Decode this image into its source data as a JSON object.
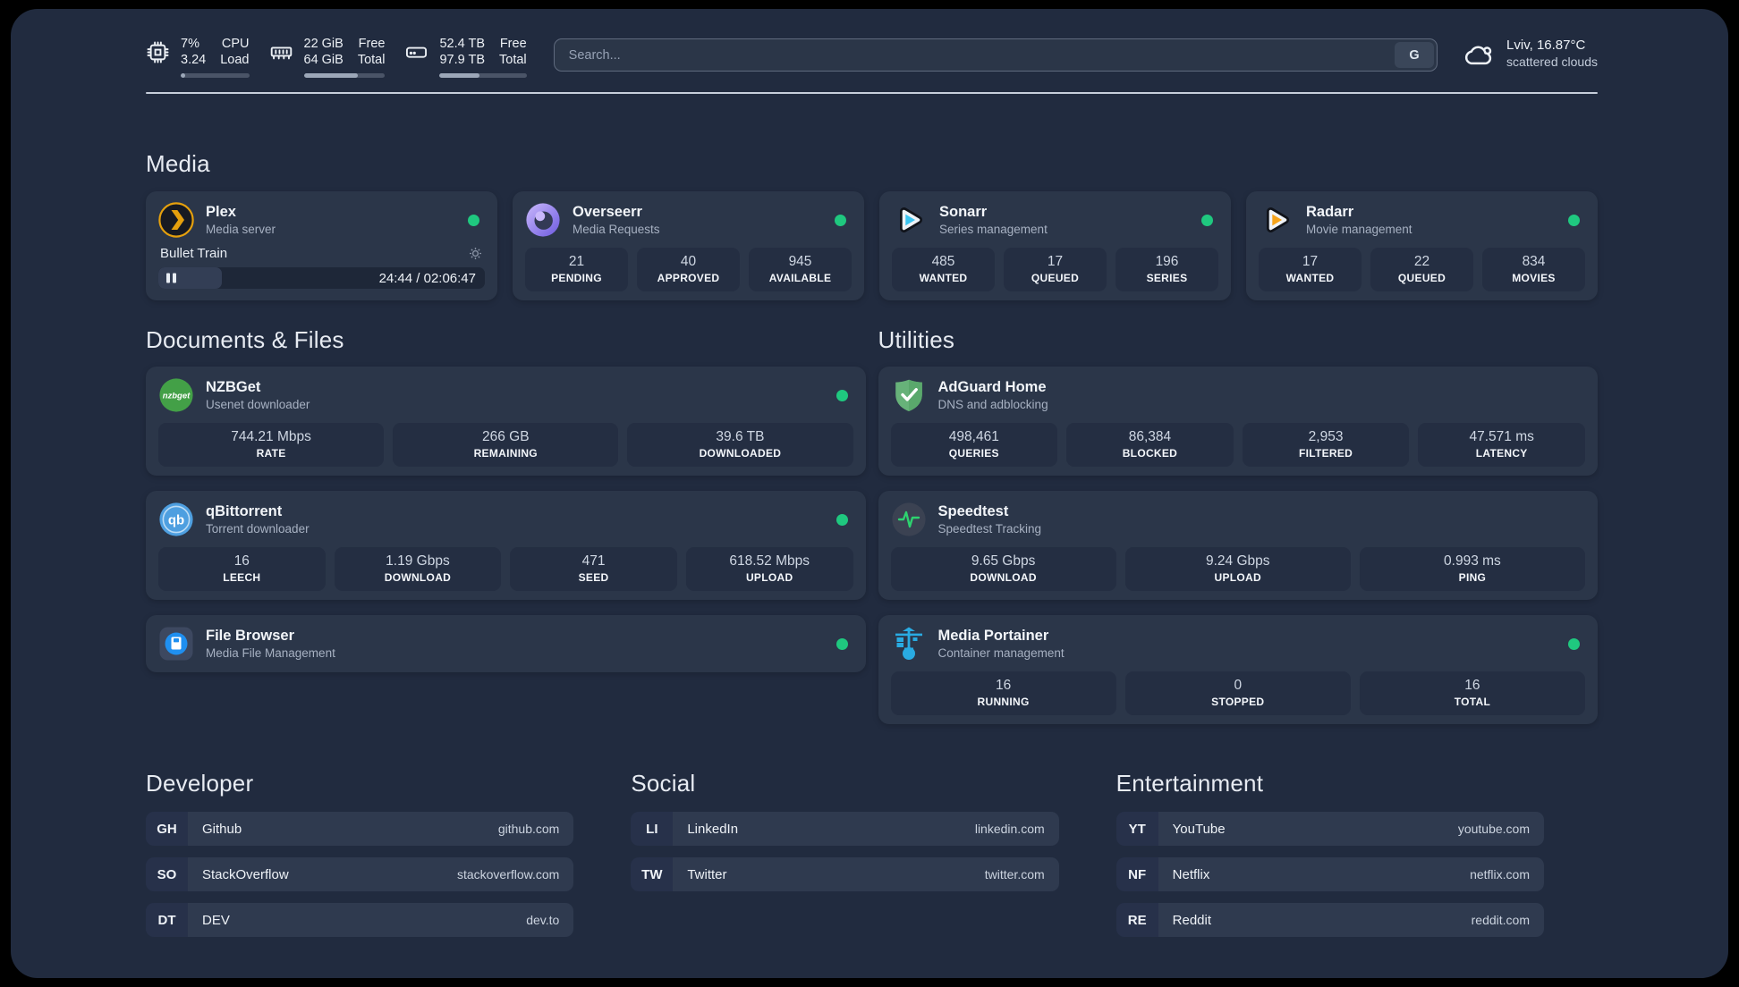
{
  "header": {
    "metrics": [
      {
        "name": "cpu",
        "values": [
          "7%",
          "3.24"
        ],
        "labels": [
          "CPU",
          "Load"
        ],
        "progress": 7
      },
      {
        "name": "ram",
        "values": [
          "22 GiB",
          "64 GiB"
        ],
        "labels": [
          "Free",
          "Total"
        ],
        "progress": 66
      },
      {
        "name": "disk",
        "values": [
          "52.4 TB",
          "97.9 TB"
        ],
        "labels": [
          "Free",
          "Total"
        ],
        "progress": 46
      }
    ],
    "search": {
      "placeholder": "Search...",
      "engine_label": "G"
    },
    "weather": {
      "summary": "Lviv, 16.87°C",
      "condition": "scattered clouds"
    }
  },
  "media": {
    "heading": "Media",
    "plex": {
      "name": "Plex",
      "desc": "Media server",
      "now_playing": "Bullet Train",
      "elapsed": "24:44 / 02:06:47",
      "progress": 19.5
    },
    "overseerr": {
      "name": "Overseerr",
      "desc": "Media Requests",
      "stats": [
        {
          "value": "21",
          "label": "PENDING"
        },
        {
          "value": "40",
          "label": "APPROVED"
        },
        {
          "value": "945",
          "label": "AVAILABLE"
        }
      ]
    },
    "sonarr": {
      "name": "Sonarr",
      "desc": "Series management",
      "stats": [
        {
          "value": "485",
          "label": "WANTED"
        },
        {
          "value": "17",
          "label": "QUEUED"
        },
        {
          "value": "196",
          "label": "SERIES"
        }
      ]
    },
    "radarr": {
      "name": "Radarr",
      "desc": "Movie management",
      "stats": [
        {
          "value": "17",
          "label": "WANTED"
        },
        {
          "value": "22",
          "label": "QUEUED"
        },
        {
          "value": "834",
          "label": "MOVIES"
        }
      ]
    }
  },
  "documents": {
    "heading": "Documents & Files",
    "nzbget": {
      "name": "NZBGet",
      "desc": "Usenet downloader",
      "stats": [
        {
          "value": "744.21 Mbps",
          "label": "RATE"
        },
        {
          "value": "266 GB",
          "label": "REMAINING"
        },
        {
          "value": "39.6 TB",
          "label": "DOWNLOADED"
        }
      ]
    },
    "qbittorrent": {
      "name": "qBittorrent",
      "desc": "Torrent downloader",
      "stats": [
        {
          "value": "16",
          "label": "LEECH"
        },
        {
          "value": "1.19 Gbps",
          "label": "DOWNLOAD"
        },
        {
          "value": "471",
          "label": "SEED"
        },
        {
          "value": "618.52 Mbps",
          "label": "UPLOAD"
        }
      ]
    },
    "filebrowser": {
      "name": "File Browser",
      "desc": "Media File Management"
    }
  },
  "utilities": {
    "heading": "Utilities",
    "adguard": {
      "name": "AdGuard Home",
      "desc": "DNS and adblocking",
      "stats": [
        {
          "value": "498,461",
          "label": "QUERIES"
        },
        {
          "value": "86,384",
          "label": "BLOCKED"
        },
        {
          "value": "2,953",
          "label": "FILTERED"
        },
        {
          "value": "47.571 ms",
          "label": "LATENCY"
        }
      ]
    },
    "speedtest": {
      "name": "Speedtest",
      "desc": "Speedtest Tracking",
      "stats": [
        {
          "value": "9.65 Gbps",
          "label": "DOWNLOAD"
        },
        {
          "value": "9.24 Gbps",
          "label": "UPLOAD"
        },
        {
          "value": "0.993 ms",
          "label": "PING"
        }
      ]
    },
    "portainer": {
      "name": "Media Portainer",
      "desc": "Container management",
      "stats": [
        {
          "value": "16",
          "label": "RUNNING"
        },
        {
          "value": "0",
          "label": "STOPPED"
        },
        {
          "value": "16",
          "label": "TOTAL"
        }
      ]
    }
  },
  "links": {
    "developer": {
      "heading": "Developer",
      "items": [
        {
          "abbr": "GH",
          "name": "Github",
          "url": "github.com"
        },
        {
          "abbr": "SO",
          "name": "StackOverflow",
          "url": "stackoverflow.com"
        },
        {
          "abbr": "DT",
          "name": "DEV",
          "url": "dev.to"
        }
      ]
    },
    "social": {
      "heading": "Social",
      "items": [
        {
          "abbr": "LI",
          "name": "LinkedIn",
          "url": "linkedin.com"
        },
        {
          "abbr": "TW",
          "name": "Twitter",
          "url": "twitter.com"
        }
      ]
    },
    "entertainment": {
      "heading": "Entertainment",
      "items": [
        {
          "abbr": "YT",
          "name": "YouTube",
          "url": "youtube.com"
        },
        {
          "abbr": "NF",
          "name": "Netflix",
          "url": "netflix.com"
        },
        {
          "abbr": "RE",
          "name": "Reddit",
          "url": "reddit.com"
        }
      ]
    }
  },
  "colors": {
    "status_online": "#1fc87f",
    "accent_green": "#2dd36f"
  }
}
